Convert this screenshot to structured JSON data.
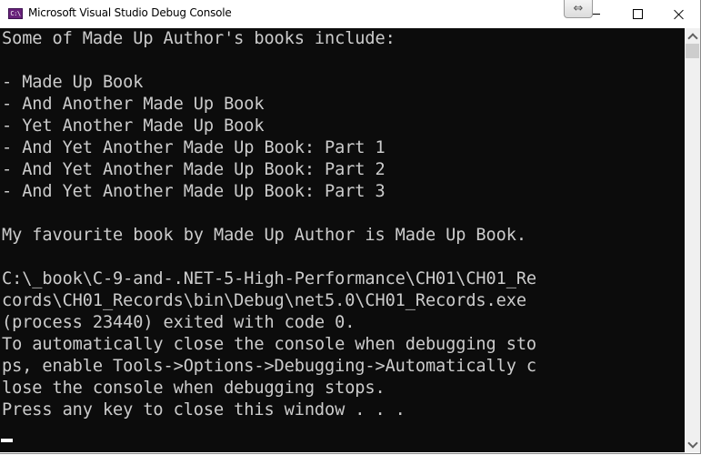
{
  "window": {
    "title": "Microsoft Visual Studio Debug Console",
    "app_icon_text": "C:\\",
    "controls": {
      "minimize": "minimize-icon",
      "maximize": "maximize-icon",
      "close": "close-icon"
    },
    "resize_overlay_glyph": "⇔"
  },
  "console": {
    "background": "#0c0c0c",
    "foreground": "#cccccc",
    "lines": [
      "Some of Made Up Author's books include:",
      "",
      "- Made Up Book",
      "- And Another Made Up Book",
      "- Yet Another Made Up Book",
      "- And Yet Another Made Up Book: Part 1",
      "- And Yet Another Made Up Book: Part 2",
      "- And Yet Another Made Up Book: Part 3",
      "",
      "My favourite book by Made Up Author is Made Up Book.",
      "",
      "C:\\_book\\C-9-and-.NET-5-High-Performance\\CH01\\CH01_Re",
      "cords\\CH01_Records\\bin\\Debug\\net5.0\\CH01_Records.exe",
      "(process 23440) exited with code 0.",
      "To automatically close the console when debugging sto",
      "ps, enable Tools->Options->Debugging->Automatically c",
      "lose the console when debugging stops.",
      "Press any key to close this window . . ."
    ]
  },
  "scrollbar": {
    "up_icon": "chevron-up-icon",
    "down_icon": "chevron-down-icon"
  }
}
